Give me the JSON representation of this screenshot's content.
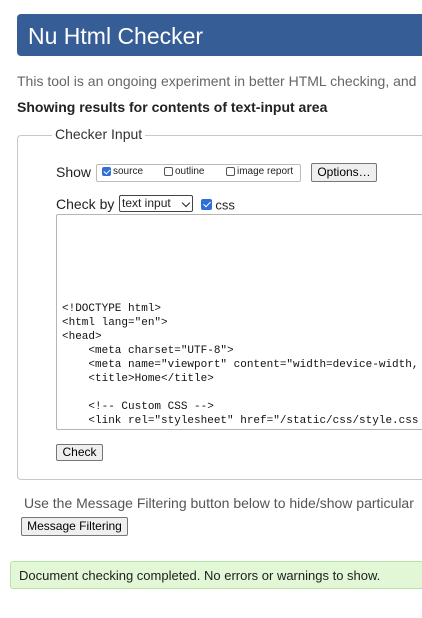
{
  "header": {
    "title": "Nu Html Checker"
  },
  "intro": {
    "text": "This tool is an ongoing experiment in better HTML checking, and"
  },
  "results_heading": "Showing results for contents of text-input area",
  "checker_input": {
    "legend": "Checker Input",
    "show_label": "Show",
    "show_options": [
      {
        "label": "source",
        "checked": true
      },
      {
        "label": "outline",
        "checked": false
      },
      {
        "label": "image report",
        "checked": false
      }
    ],
    "options_button": "Options…",
    "check_by_label": "Check by",
    "check_by_value": "text input",
    "css_label": "css",
    "css_checked": true,
    "source_lines": [
      "<!DOCTYPE html>",
      "<html lang=\"en\">",
      "<head>",
      "    <meta charset=\"UTF-8\">",
      "    <meta name=\"viewport\" content=\"width=device-width,",
      "    <title>Home</title>",
      "",
      "    <!-- Custom CSS -->",
      "    <link rel=\"stylesheet\" href=\"/static/css/style.css"
    ],
    "check_button": "Check"
  },
  "filtering": {
    "note": "Use the Message Filtering button below to hide/show particular",
    "button": "Message Filtering"
  },
  "status": {
    "message": "Document checking completed. No errors or warnings to show.",
    "colors": {
      "background": "#e1f7d6",
      "border": "#b9e3a6"
    }
  },
  "colors": {
    "banner": "#365d95",
    "checkbox_checked": "#2f6fd6"
  }
}
